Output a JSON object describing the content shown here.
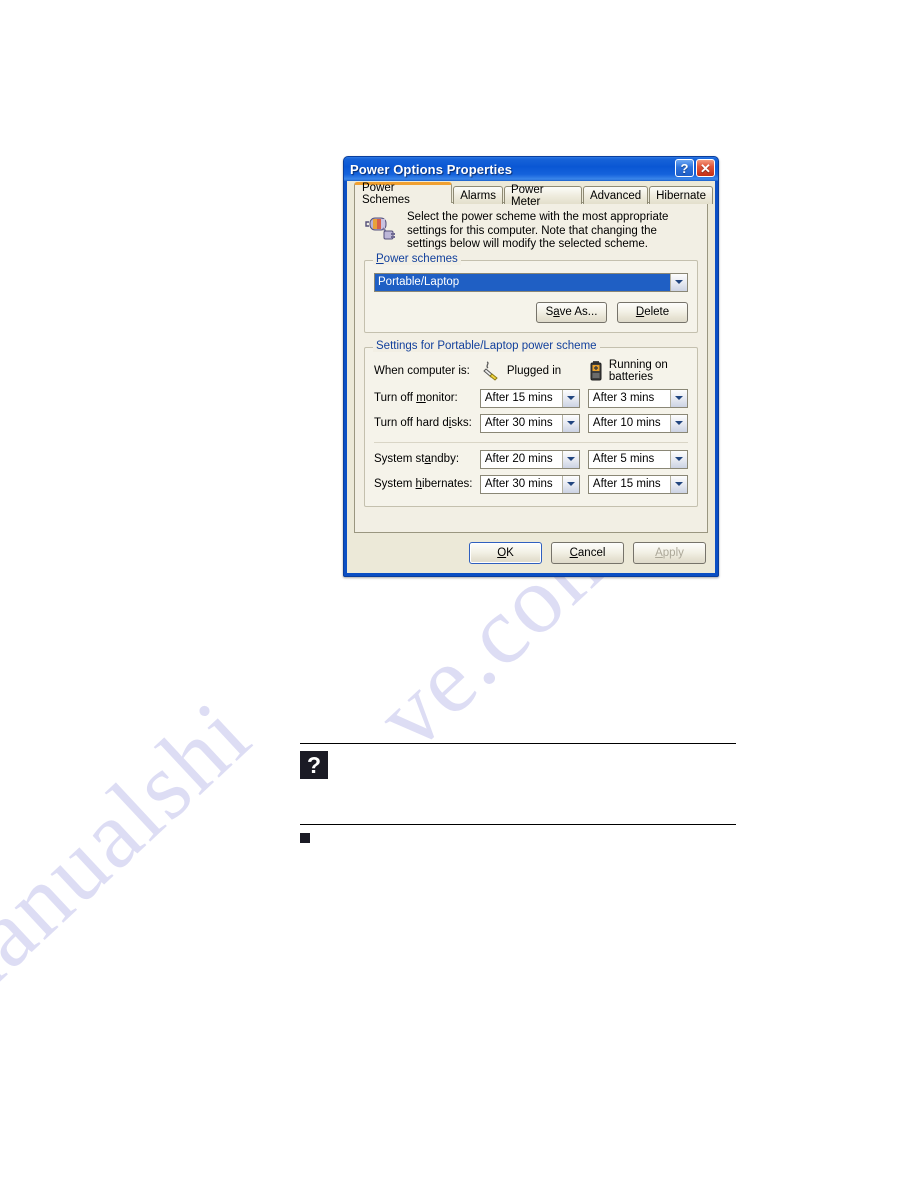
{
  "page": {
    "watermark_text_left": "manualshi",
    "watermark_text_right": "ve.com"
  },
  "dialog": {
    "title": "Power Options Properties",
    "titlebar_buttons": [
      {
        "name": "help-button",
        "glyph": "?"
      },
      {
        "name": "close-button",
        "glyph": "✕"
      }
    ],
    "tabs": [
      {
        "label": "Power Schemes",
        "active": true
      },
      {
        "label": "Alarms",
        "active": false
      },
      {
        "label": "Power Meter",
        "active": false
      },
      {
        "label": "Advanced",
        "active": false
      },
      {
        "label": "Hibernate",
        "active": false
      }
    ],
    "description": "Select the power scheme with the most appropriate settings for this computer. Note that changing the settings below will modify the selected scheme.",
    "description_icon": "power-scheme-icon",
    "power_schemes_group": {
      "title": "Power schemes",
      "title_accel": "P",
      "selected_scheme": "Portable/Laptop",
      "buttons": [
        {
          "label_pre": "S",
          "label_accel": "a",
          "label_post": "ve As...",
          "name": "save-as-button"
        },
        {
          "label_pre": "",
          "label_accel": "D",
          "label_post": "elete",
          "name": "delete-button"
        }
      ]
    },
    "settings_group": {
      "title": "Settings for Portable/Laptop power scheme",
      "header_label": "When computer is:",
      "columns": [
        {
          "label": "Plugged in",
          "icon": "power-plug-icon"
        },
        {
          "label": "Running on batteries",
          "icon": "battery-icon"
        }
      ],
      "rows": [
        {
          "label_pre": "Turn off ",
          "label_accel": "m",
          "label_post": "onitor:",
          "plugged_in": "After 15 mins",
          "batteries": "After 3 mins"
        },
        {
          "label_pre": "Turn off hard d",
          "label_accel": "i",
          "label_post": "sks:",
          "plugged_in": "After 30 mins",
          "batteries": "After 10 mins"
        },
        {
          "label_pre": "System st",
          "label_accel": "a",
          "label_post": "ndby:",
          "plugged_in": "After 20 mins",
          "batteries": "After 5 mins"
        },
        {
          "label_pre": "System ",
          "label_accel": "h",
          "label_post": "ibernates:",
          "plugged_in": "After 30 mins",
          "batteries": "After 15 mins"
        }
      ]
    },
    "footer_buttons": [
      {
        "label_pre": "",
        "label_accel": "O",
        "label_post": "K",
        "name": "ok-button",
        "state": "default"
      },
      {
        "label_pre": "",
        "label_accel": "C",
        "label_post": "ancel",
        "name": "cancel-button",
        "state": "normal"
      },
      {
        "label_pre": "",
        "label_accel": "A",
        "label_post": "pply",
        "name": "apply-button",
        "state": "disabled"
      }
    ]
  },
  "note": {
    "icon_glyph": "?",
    "icon_name": "note-question-icon"
  },
  "colors": {
    "titlebar_blue": "#0a57d4",
    "accent_orange": "#f0a030",
    "group_label_blue": "#12409c",
    "selection_blue": "#1f5fc4",
    "dialog_face": "#ece9d8",
    "tabpage_face": "#f2efe4",
    "close_red": "#c32f16",
    "watermark_lavender": "#c9c9ee"
  }
}
